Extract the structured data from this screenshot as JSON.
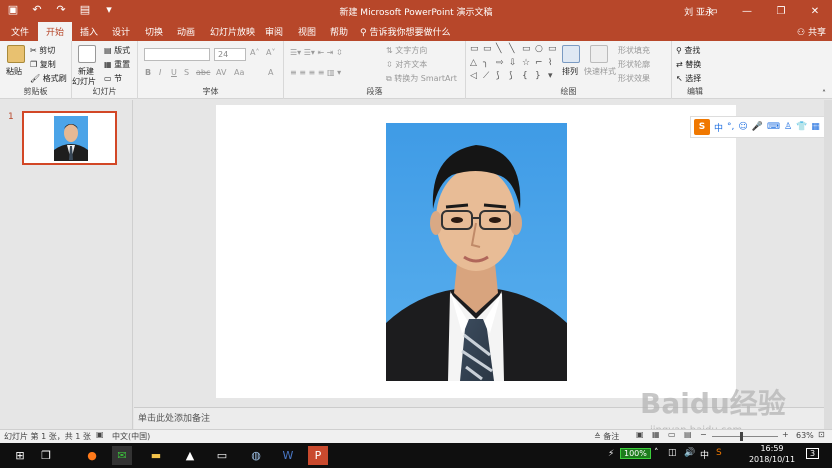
{
  "window": {
    "title": "新建 Microsoft PowerPoint 演示文稿",
    "user": "刘 亚永",
    "share_label": "共享",
    "colors": {
      "accent": "#b7472a",
      "slide_bg": "#ffffff",
      "photo_bg": "#4ba4e8"
    }
  },
  "qat": {
    "save_icon": "save-icon",
    "undo_icon": "undo-icon",
    "redo_icon": "redo-icon",
    "start_icon": "start-from-beginning-icon"
  },
  "tabs": [
    {
      "label": "文件"
    },
    {
      "label": "开始"
    },
    {
      "label": "插入"
    },
    {
      "label": "设计"
    },
    {
      "label": "切换"
    },
    {
      "label": "动画"
    },
    {
      "label": "幻灯片放映"
    },
    {
      "label": "审阅"
    },
    {
      "label": "视图"
    },
    {
      "label": "帮助"
    }
  ],
  "active_tab": "开始",
  "tell_me": "告诉我你想要做什么",
  "ribbon": {
    "clipboard": {
      "label": "剪贴板",
      "paste": "粘贴",
      "cut": "剪切",
      "copy": "复制",
      "format_painter": "格式刷"
    },
    "slides": {
      "label": "幻灯片",
      "new_slide_1": "新建",
      "new_slide_2": "幻灯片",
      "layout": "版式",
      "reset": "重置",
      "section": "节"
    },
    "font": {
      "label": "字体",
      "size": "24",
      "bold": "B",
      "italic": "I",
      "underline": "U",
      "shadow": "S",
      "strike": "abc",
      "spacing": "AV",
      "case": "Aa",
      "color": "A"
    },
    "paragraph": {
      "label": "段落",
      "text_direction": "文字方向",
      "align_text": "对齐文本",
      "smartart": "转换为 SmartArt"
    },
    "drawing": {
      "label": "绘图",
      "arrange": "排列",
      "quick_styles": "快速样式",
      "shape_fill": "形状填充",
      "shape_outline": "形状轮廓",
      "shape_effects": "形状效果"
    },
    "editing": {
      "label": "编辑",
      "find": "查找",
      "replace": "替换",
      "select": "选择"
    }
  },
  "slides_panel": {
    "slide_number": "1"
  },
  "notes_placeholder": "单击此处添加备注",
  "status": {
    "slide_info": "幻灯片 第 1 张，共 1 张",
    "language": "中文(中国)",
    "notes": "备注",
    "zoom": "63%"
  },
  "ime_bar": {
    "mode": "中"
  },
  "taskbar": {
    "battery": "100%",
    "time": "16:59",
    "date": "2018/10/11",
    "notification_count": "3"
  },
  "watermark": {
    "text": "Baidu经验",
    "url": "jingyan.baidu.com"
  }
}
